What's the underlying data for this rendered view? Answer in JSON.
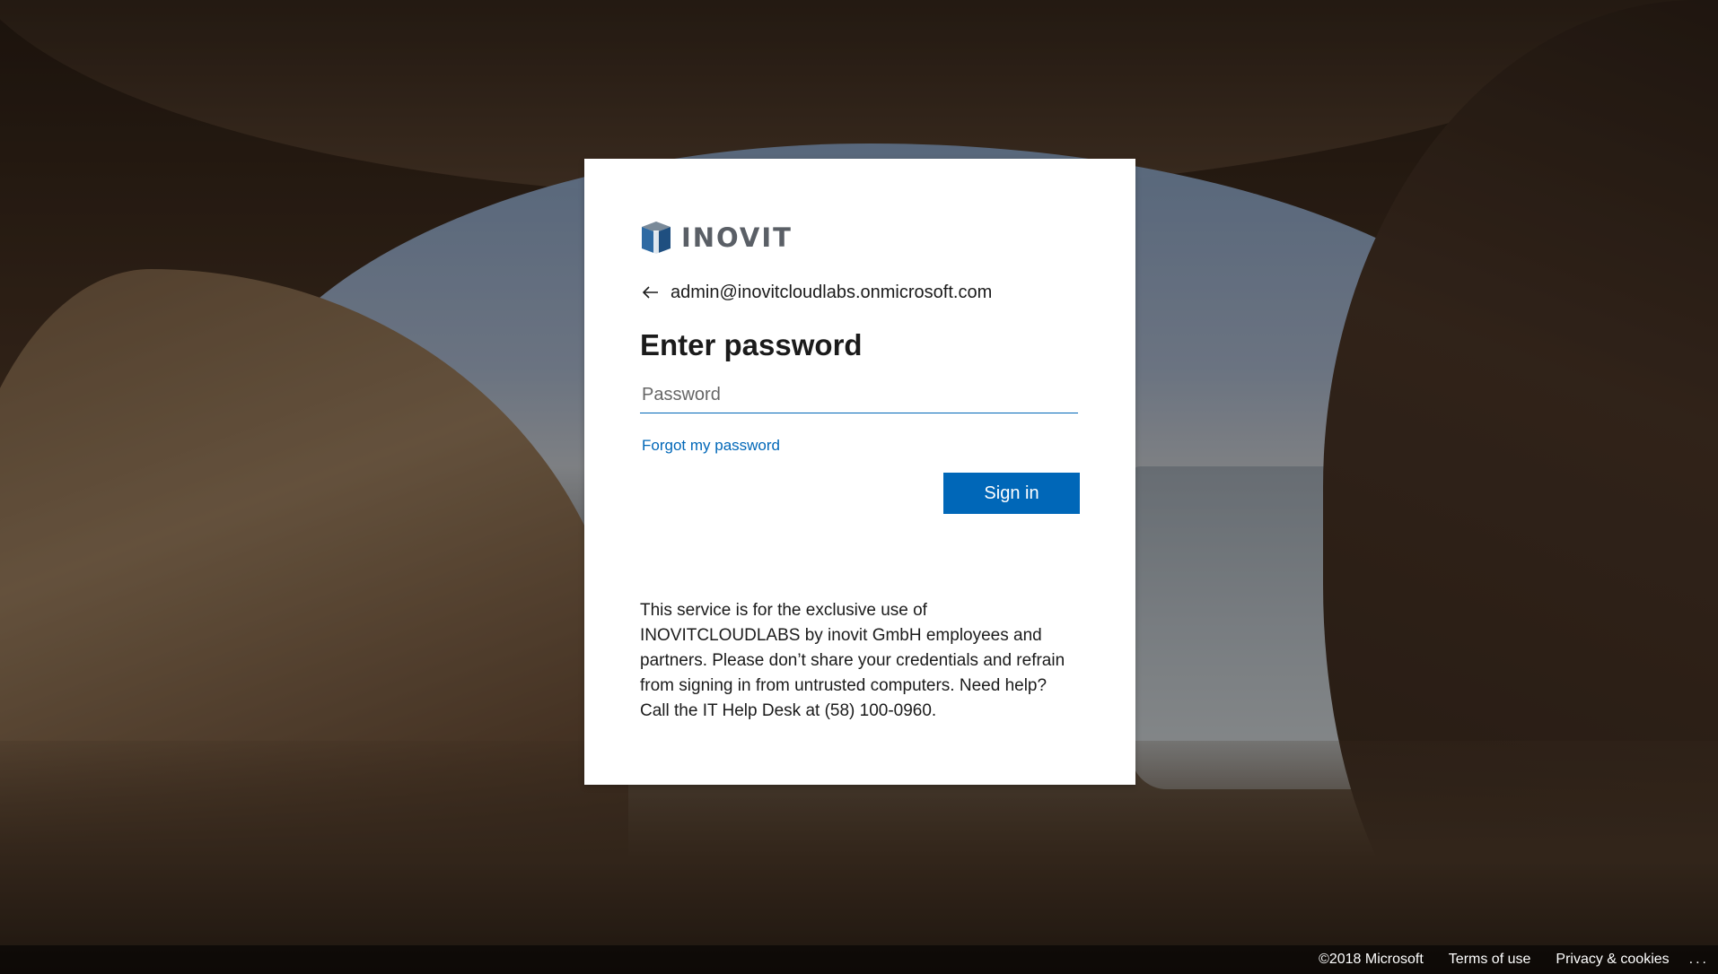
{
  "brand": {
    "name": "INOVIT",
    "colors": {
      "accent": "#0067b8",
      "logo_blue": "#2e6aa3",
      "logo_gray": "#5a5f66"
    }
  },
  "identity": {
    "back_icon": "arrow-left-icon",
    "email": "admin@inovitcloudlabs.onmicrosoft.com"
  },
  "title": "Enter password",
  "password": {
    "placeholder": "Password",
    "value": ""
  },
  "forgot_link": "Forgot my password",
  "signin_label": "Sign in",
  "notice": "This service is for the exclusive use of INOVITCLOUDLABS by inovit GmbH employees and partners. Please don’t share your credentials and refrain from signing in from untrusted computers. Need help? Call the IT Help Desk at (58) 100-0960.",
  "footer": {
    "copyright": "©2018 Microsoft",
    "terms": "Terms of use",
    "privacy": "Privacy & cookies",
    "more": "..."
  }
}
